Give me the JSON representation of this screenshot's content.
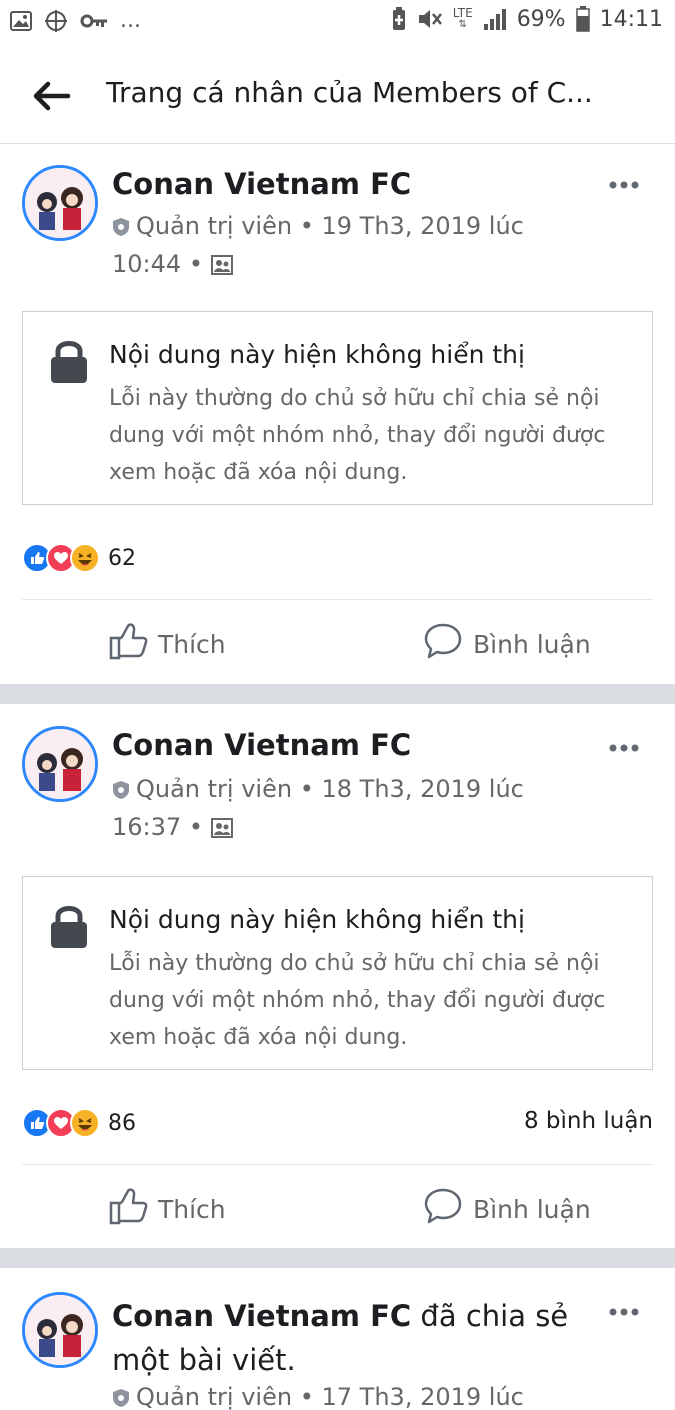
{
  "status_bar": {
    "left_icons": [
      "image-icon",
      "crosshair-icon",
      "key-icon"
    ],
    "more": "...",
    "network": "LTE",
    "battery": "69%",
    "time": "14:11"
  },
  "app_bar": {
    "title": "Trang cá nhân của Members of C..."
  },
  "posts": [
    {
      "author": "Conan Vietnam FC",
      "role": "Quản trị viên",
      "date": "• 19 Th3, 2019 lúc",
      "time": "10:44",
      "locked_title": "Nội dung này hiện không hiển thị",
      "locked_body": "Lỗi này thường do chủ sở hữu chỉ chia sẻ nội dung với một nhóm nhỏ, thay đổi người được xem hoặc đã xóa nội dung.",
      "reaction_count": "62",
      "comment_count": "",
      "like_label": "Thích",
      "comment_label": "Bình luận"
    },
    {
      "author": "Conan Vietnam FC",
      "role": "Quản trị viên",
      "date": "• 18 Th3, 2019 lúc",
      "time": "16:37",
      "locked_title": "Nội dung này hiện không hiển thị",
      "locked_body": "Lỗi này thường do chủ sở hữu chỉ chia sẻ nội dung với một nhóm nhỏ, thay đổi người được xem hoặc đã xóa nội dung.",
      "reaction_count": "86",
      "comment_count": "8 bình luận",
      "like_label": "Thích",
      "comment_label": "Bình luận"
    },
    {
      "author": "Conan Vietnam FC",
      "shared_text": " đã chia sẻ",
      "shared_line2": "một bài viết.",
      "role": "Quản trị viên",
      "date": "• 17 Th3, 2019 lúc"
    }
  ],
  "colors": {
    "accent": "#1877f2",
    "avatar_ring": "#2d88ff",
    "love": "#f33e58",
    "haha": "#f7b125",
    "separator": "#dadde1"
  }
}
